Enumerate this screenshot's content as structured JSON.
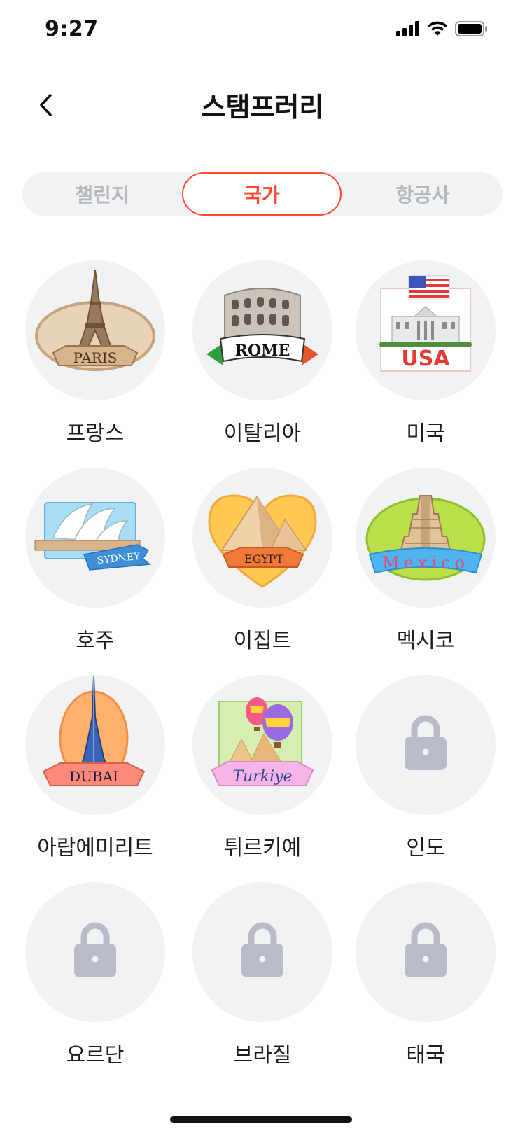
{
  "status": {
    "time": "9:27"
  },
  "header": {
    "title": "스탬프러리"
  },
  "tabs": [
    {
      "label": "챌린지",
      "active": false
    },
    {
      "label": "국가",
      "active": true
    },
    {
      "label": "항공사",
      "active": false
    }
  ],
  "colors": {
    "accent": "#ff4a2f",
    "badge_bg": "#f1f2f4",
    "lock": "#b9bcc8"
  },
  "countries": [
    {
      "name": "프랑스",
      "stamp_text": "PARIS",
      "unlocked": true
    },
    {
      "name": "이탈리아",
      "stamp_text": "ROME",
      "unlocked": true
    },
    {
      "name": "미국",
      "stamp_text": "USA",
      "unlocked": true
    },
    {
      "name": "호주",
      "stamp_text": "SYDNEY",
      "unlocked": true
    },
    {
      "name": "이집트",
      "stamp_text": "EGYPT",
      "unlocked": true
    },
    {
      "name": "멕시코",
      "stamp_text": "Mexico",
      "unlocked": true
    },
    {
      "name": "아랍에미리트",
      "stamp_text": "DUBAI",
      "unlocked": true
    },
    {
      "name": "튀르키예",
      "stamp_text": "Turkiye",
      "unlocked": true
    },
    {
      "name": "인도",
      "unlocked": false,
      "icon": "lock-icon"
    },
    {
      "name": "요르단",
      "unlocked": false,
      "icon": "lock-icon"
    },
    {
      "name": "브라질",
      "unlocked": false,
      "icon": "lock-icon"
    },
    {
      "name": "태국",
      "unlocked": false,
      "icon": "lock-icon"
    }
  ]
}
